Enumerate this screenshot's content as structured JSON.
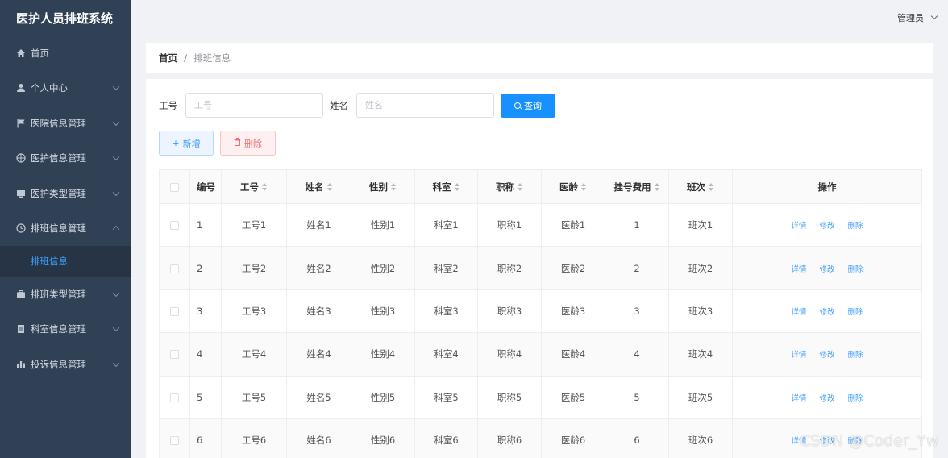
{
  "app": {
    "title": "医护人员排班系统"
  },
  "header": {
    "user": "管理员"
  },
  "sidebar": {
    "items": [
      {
        "label": "首页",
        "icon": "home-icon"
      },
      {
        "label": "个人中心",
        "icon": "user-icon"
      },
      {
        "label": "医院信息管理",
        "icon": "flag-icon"
      },
      {
        "label": "医护信息管理",
        "icon": "globe-icon"
      },
      {
        "label": "医护类型管理",
        "icon": "monitor-icon"
      },
      {
        "label": "排班信息管理",
        "icon": "clock-icon"
      },
      {
        "label": "排班类型管理",
        "icon": "suitcase-icon"
      },
      {
        "label": "科室信息管理",
        "icon": "document-icon"
      },
      {
        "label": "投诉信息管理",
        "icon": "bar-chart-icon"
      }
    ],
    "submenu": {
      "label": "排班信息"
    }
  },
  "breadcrumb": {
    "home": "首页",
    "separator": "/",
    "current": "排班信息"
  },
  "search": {
    "gonghao_label": "工号",
    "gonghao_placeholder": "工号",
    "name_label": "姓名",
    "name_placeholder": "姓名",
    "query_button": "查询"
  },
  "actions": {
    "add": "新增",
    "delete": "删除"
  },
  "table": {
    "headers": {
      "index": "编号",
      "gonghao": "工号",
      "name": "姓名",
      "gender": "性别",
      "dept": "科室",
      "title": "职称",
      "seniority": "医龄",
      "fee": "挂号费用",
      "shift": "班次",
      "ops": "操作"
    },
    "rows": [
      {
        "index": "1",
        "gonghao": "工号1",
        "name": "姓名1",
        "gender": "性别1",
        "dept": "科室1",
        "title": "职称1",
        "seniority": "医龄1",
        "fee": "1",
        "shift": "班次1"
      },
      {
        "index": "2",
        "gonghao": "工号2",
        "name": "姓名2",
        "gender": "性别2",
        "dept": "科室2",
        "title": "职称2",
        "seniority": "医龄2",
        "fee": "2",
        "shift": "班次2"
      },
      {
        "index": "3",
        "gonghao": "工号3",
        "name": "姓名3",
        "gender": "性别3",
        "dept": "科室3",
        "title": "职称3",
        "seniority": "医龄3",
        "fee": "3",
        "shift": "班次3"
      },
      {
        "index": "4",
        "gonghao": "工号4",
        "name": "姓名4",
        "gender": "性别4",
        "dept": "科室4",
        "title": "职称4",
        "seniority": "医龄4",
        "fee": "4",
        "shift": "班次4"
      },
      {
        "index": "5",
        "gonghao": "工号5",
        "name": "姓名5",
        "gender": "性别5",
        "dept": "科室5",
        "title": "职称5",
        "seniority": "医龄5",
        "fee": "5",
        "shift": "班次5"
      },
      {
        "index": "6",
        "gonghao": "工号6",
        "name": "姓名6",
        "gender": "性别6",
        "dept": "科室6",
        "title": "职称6",
        "seniority": "医龄6",
        "fee": "6",
        "shift": "班次6"
      }
    ],
    "row_ops": {
      "detail": "详情",
      "edit": "修改",
      "delete": "删除"
    }
  },
  "watermark": "CSDN @Coder_Yw",
  "colors": {
    "sidebar": "#304156",
    "accent": "#1890ff",
    "danger": "#f56c6c"
  }
}
